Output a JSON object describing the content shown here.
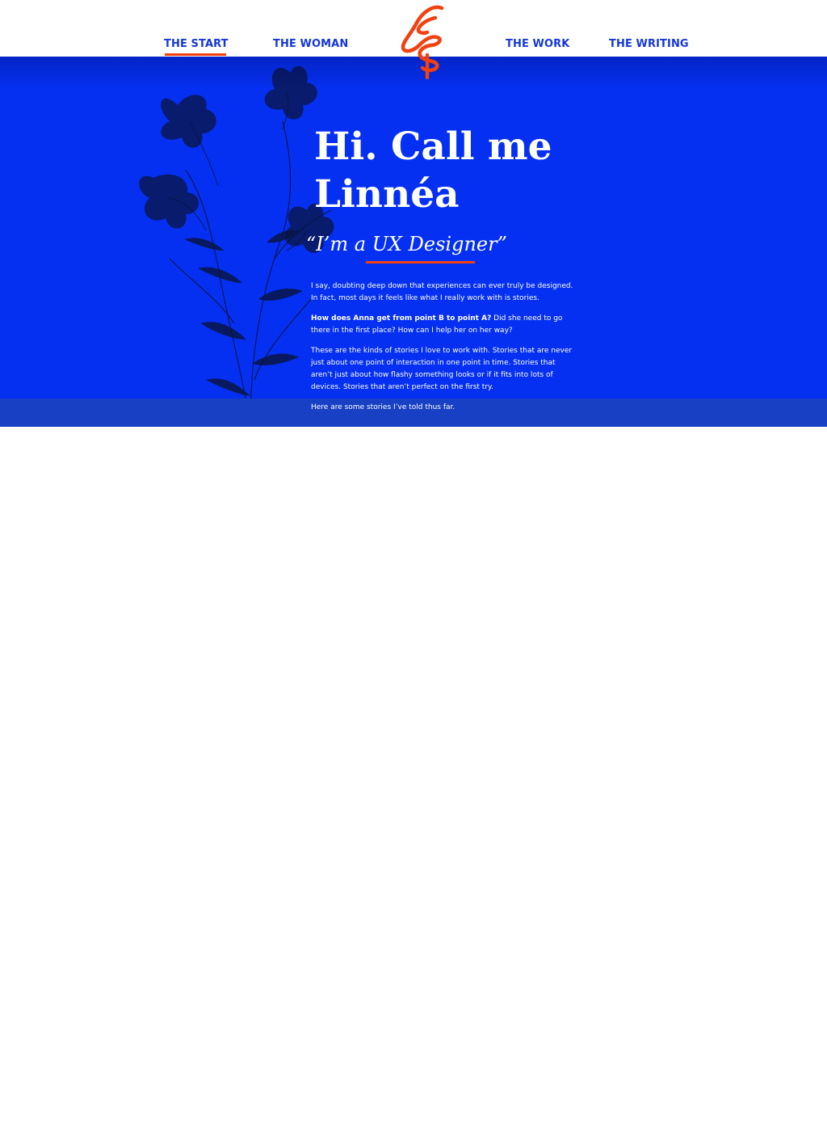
{
  "nav": {
    "start": "THE START",
    "woman": "THE WOMAN",
    "work": "THE WORK",
    "writing": "THE WRITING"
  },
  "hero": {
    "title_line1": "Hi. Call me",
    "title_line2": "Linnéa",
    "subtitle": "“I’m a UX Designer”",
    "p1": "I say, doubting deep down that experiences can ever truly be designed. In fact, most days it feels like what I really work with is stories.",
    "p2_bold": "How does Anna get from point B to point A?",
    "p2_rest": " Did she need to go there in the first place? How can I help her on her way?",
    "p3": "These are the kinds of stories I love to work with. Stories that are never just about one point of interaction in one point in time. Stories that aren’t just about how flashy something looks or if it fits into lots of devices. Stories that aren’t perfect on the first try.",
    "p4": "Here are some stories I’ve told thus far."
  },
  "colors": {
    "brand_blue": "#0530f2",
    "nav_blue": "#1438d6",
    "accent_orange": "#f2400f",
    "band_blue": "#1740c4"
  },
  "icons": {
    "logo": "ls-monogram-logo",
    "illustration": "lily-flower-illustration"
  }
}
